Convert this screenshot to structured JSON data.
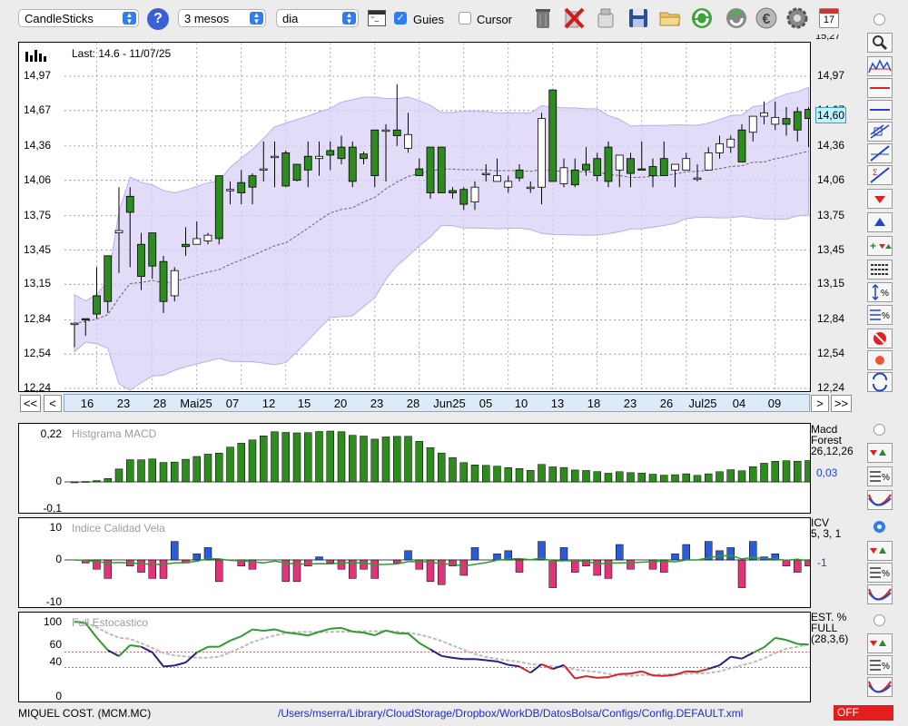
{
  "toolbar": {
    "chart_type": "CandleSticks",
    "period": "3 mesos",
    "interval": "dia",
    "guides_label": "Guies",
    "guides_checked": true,
    "cursor_label": "Cursor",
    "cursor_checked": false,
    "help_icon": "help-icon",
    "icons": [
      "terminal-icon",
      "trash-icon",
      "delete-icon",
      "clean-icon",
      "save-icon",
      "folder-icon",
      "refresh-icon",
      "sync-icon",
      "euro-icon",
      "gear-icon",
      "calendar-icon"
    ],
    "calendar_day": "17"
  },
  "price_chart": {
    "last_label": "Last: 14.6 - 11/07/25",
    "current_value": "14,60",
    "top_label": "15,27",
    "y_ticks": [
      "14,97",
      "14,67",
      "14,36",
      "14,06",
      "13,75",
      "13,45",
      "13,15",
      "12,84",
      "12,54",
      "12,24"
    ],
    "x_ticks": [
      "16",
      "23",
      "28",
      "Mai25",
      "07",
      "12",
      "15",
      "20",
      "23",
      "28",
      "Jun25",
      "05",
      "10",
      "13",
      "18",
      "23",
      "26",
      "Jul25",
      "04",
      "09"
    ],
    "nav_buttons": [
      "<<",
      "<",
      ">",
      ">>"
    ]
  },
  "macd": {
    "title": "Histgrama MACD",
    "name": "Macd",
    "name2": "Forest",
    "params": "26,12,26",
    "value": "0,03",
    "y_ticks": [
      "0,22",
      "0",
      "-0,1"
    ]
  },
  "icv": {
    "title": "Indice Calidad Vela",
    "name": "ICV",
    "params": "5, 3, 1",
    "value": "-1",
    "y_ticks": [
      "10",
      "0",
      "-10"
    ]
  },
  "stoch": {
    "title": "Full Estocastico",
    "name": "EST. %",
    "name2": "FULL",
    "params": "(28,3,6)",
    "y_ticks": [
      "100",
      "60",
      "40",
      "0"
    ]
  },
  "statusbar": {
    "ticker": "MIQUEL COST. (MCM.MC)",
    "path": "/Users/mserra/Library/CloudStorage/Dropbox/WorkDB/DatosBolsa/Configs/Config.DEFAULT.xml",
    "off_label": "OFF"
  },
  "colors": {
    "up": "#ffffff",
    "down": "#2e8b1e",
    "accent": "#2f7cf6",
    "band": "#d8d0f6",
    "neg": "#d92020"
  },
  "chart_data": {
    "type": "candlestick",
    "ylim": [
      12.24,
      15.27
    ],
    "candles": [
      [
        12.81,
        12.81,
        12.6,
        12.81
      ],
      [
        12.85,
        12.85,
        12.7,
        12.84
      ],
      [
        13.05,
        13.3,
        12.85,
        12.89
      ],
      [
        13.4,
        13.4,
        12.9,
        13.0
      ],
      [
        13.6,
        14.0,
        13.25,
        13.62
      ],
      [
        13.92,
        14.0,
        13.3,
        13.78
      ],
      [
        13.5,
        13.6,
        13.1,
        13.22
      ],
      [
        13.6,
        13.6,
        13.2,
        13.31
      ],
      [
        13.35,
        13.4,
        12.9,
        13.0
      ],
      [
        13.05,
        13.3,
        13.0,
        13.27
      ],
      [
        13.5,
        13.65,
        13.4,
        13.48
      ],
      [
        13.5,
        13.7,
        13.5,
        13.55
      ],
      [
        13.53,
        13.6,
        13.5,
        13.58
      ],
      [
        14.1,
        14.1,
        13.5,
        13.55
      ],
      [
        13.98,
        14.05,
        13.85,
        13.98
      ],
      [
        14.04,
        14.15,
        13.85,
        13.95
      ],
      [
        14.1,
        14.12,
        13.85,
        14.0
      ],
      [
        14.16,
        14.4,
        14.05,
        14.16
      ],
      [
        14.27,
        14.4,
        14.0,
        14.27
      ],
      [
        14.3,
        14.32,
        14.0,
        14.01
      ],
      [
        14.2,
        14.2,
        14.05,
        14.06
      ],
      [
        14.27,
        14.4,
        14.0,
        14.15
      ],
      [
        14.25,
        14.4,
        14.1,
        14.27
      ],
      [
        14.32,
        14.4,
        14.15,
        14.28
      ],
      [
        14.35,
        14.45,
        14.2,
        14.25
      ],
      [
        14.35,
        14.4,
        14.0,
        14.05
      ],
      [
        14.29,
        14.31,
        14.2,
        14.25
      ],
      [
        14.5,
        14.5,
        14.0,
        14.1
      ],
      [
        14.5,
        14.55,
        14.05,
        14.5
      ],
      [
        14.5,
        14.9,
        14.36,
        14.45
      ],
      [
        14.34,
        14.65,
        14.3,
        14.46
      ],
      [
        14.16,
        14.25,
        14.1,
        14.1
      ],
      [
        14.35,
        14.35,
        13.9,
        13.95
      ],
      [
        14.35,
        14.35,
        13.95,
        13.95
      ],
      [
        13.97,
        14.0,
        13.9,
        13.95
      ],
      [
        13.98,
        14.0,
        13.8,
        13.85
      ],
      [
        13.87,
        14.05,
        13.8,
        14.0
      ],
      [
        14.12,
        14.2,
        14.05,
        14.12
      ],
      [
        14.05,
        14.25,
        14.05,
        14.1
      ],
      [
        14.0,
        14.1,
        13.95,
        14.05
      ],
      [
        14.15,
        14.2,
        14.05,
        14.08
      ],
      [
        14.0,
        14.05,
        13.95,
        14.0
      ],
      [
        14.0,
        14.65,
        13.85,
        14.6
      ],
      [
        14.85,
        14.85,
        14.1,
        14.05
      ],
      [
        14.03,
        14.25,
        14.0,
        14.17
      ],
      [
        14.15,
        14.25,
        14.0,
        14.02
      ],
      [
        14.2,
        14.35,
        14.1,
        14.15
      ],
      [
        14.25,
        14.3,
        14.05,
        14.1
      ],
      [
        14.35,
        14.4,
        14.0,
        14.05
      ],
      [
        14.15,
        14.2,
        14.0,
        14.28
      ],
      [
        14.25,
        14.3,
        14.0,
        14.12
      ],
      [
        14.16,
        14.4,
        14.15,
        14.15
      ],
      [
        14.18,
        14.25,
        14.0,
        14.1
      ],
      [
        14.25,
        14.4,
        14.1,
        14.1
      ],
      [
        14.15,
        14.2,
        14.0,
        14.2
      ],
      [
        14.15,
        14.3,
        14.15,
        14.25
      ],
      [
        14.08,
        14.2,
        14.05,
        14.08
      ],
      [
        14.15,
        14.35,
        14.15,
        14.3
      ],
      [
        14.3,
        14.45,
        14.25,
        14.38
      ],
      [
        14.35,
        14.45,
        14.3,
        14.42
      ],
      [
        14.5,
        14.55,
        14.3,
        14.22
      ],
      [
        14.48,
        14.6,
        14.4,
        14.62
      ],
      [
        14.62,
        14.75,
        14.55,
        14.65
      ],
      [
        14.55,
        14.75,
        14.5,
        14.61
      ],
      [
        14.6,
        14.7,
        14.45,
        14.55
      ],
      [
        14.66,
        14.7,
        14.4,
        14.5
      ],
      [
        14.68,
        14.7,
        14.35,
        14.6
      ]
    ]
  }
}
